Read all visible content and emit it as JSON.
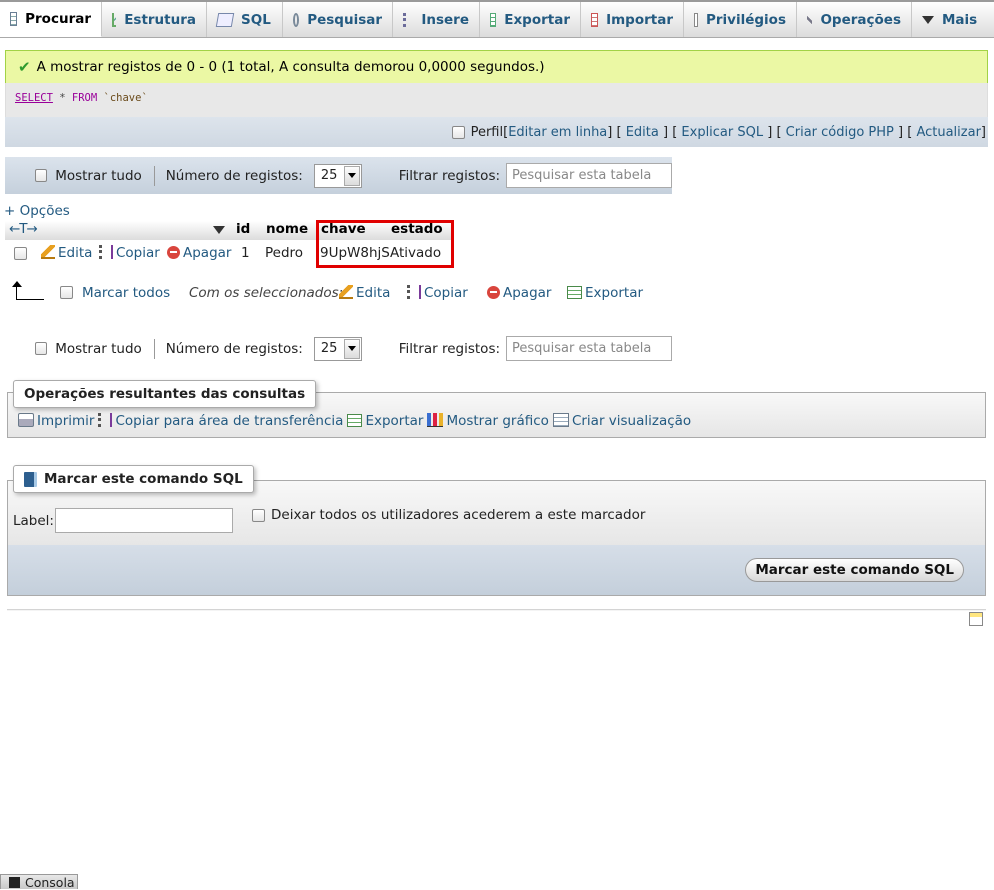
{
  "tabs": [
    {
      "label": "Procurar",
      "icon": "browse-table-icon",
      "active": true
    },
    {
      "label": "Estrutura",
      "icon": "structure-icon"
    },
    {
      "label": "SQL",
      "icon": "sql-icon"
    },
    {
      "label": "Pesquisar",
      "icon": "search-icon"
    },
    {
      "label": "Insere",
      "icon": "insert-icon"
    },
    {
      "label": "Exportar",
      "icon": "export-icon"
    },
    {
      "label": "Importar",
      "icon": "import-icon"
    },
    {
      "label": "Privilégios",
      "icon": "privileges-icon"
    },
    {
      "label": "Operações",
      "icon": "operations-icon"
    },
    {
      "label": "Mais",
      "icon": "chevron-down-icon"
    }
  ],
  "message": {
    "text": "A mostrar registos de 0 - 0 (1 total, A consulta demorou 0,0000 segundos.)",
    "status_color": "#ebf8a4"
  },
  "sql": {
    "select_kw": "SELECT",
    "star": " * ",
    "from_kw": "FROM",
    "table": " `chave`"
  },
  "sql_actions": {
    "profiling": "Perfil",
    "edit_inline": "Editar em linha",
    "edit": "Edita",
    "explain": "Explicar SQL",
    "create_php": "Criar código PHP",
    "refresh": "Actualizar"
  },
  "nav": {
    "show_all": "Mostrar tudo",
    "rows_label": "Número de registos:",
    "rows_value": "25",
    "filter_label": "Filtrar registos:",
    "filter_placeholder": "Pesquisar esta tabela"
  },
  "options_link": "+ Opções",
  "resize_control": "←T→",
  "columns": [
    "id",
    "nome",
    "chave",
    "estado"
  ],
  "rows": [
    {
      "actions": {
        "edit": "Edita",
        "copy": "Copiar",
        "delete": "Apagar"
      },
      "id": "1",
      "nome": "Pedro",
      "chave": "9UpW8hjS",
      "estado": "Ativado"
    }
  ],
  "bulk": {
    "check_all": "Marcar todos",
    "with_selected": "Com os seleccionados:",
    "edit": "Edita",
    "copy": "Copiar",
    "delete": "Apagar",
    "export": "Exportar"
  },
  "query_results": {
    "legend": "Operações resultantes das consultas",
    "print": "Imprimir",
    "copy_clipboard": "Copiar para área de transferência",
    "export": "Exportar",
    "chart": "Mostrar gráfico",
    "create_view": "Criar visualização"
  },
  "bookmark": {
    "legend": "Marcar este comando SQL",
    "label": "Label:",
    "label_value": "",
    "share": "Deixar todos os utilizadores acederem a este marcador",
    "submit": "Marcar este comando SQL"
  },
  "console": "Consola",
  "colors": {
    "link": "#235a81",
    "highlight": "#e00000",
    "success_border": "#a2d246"
  }
}
